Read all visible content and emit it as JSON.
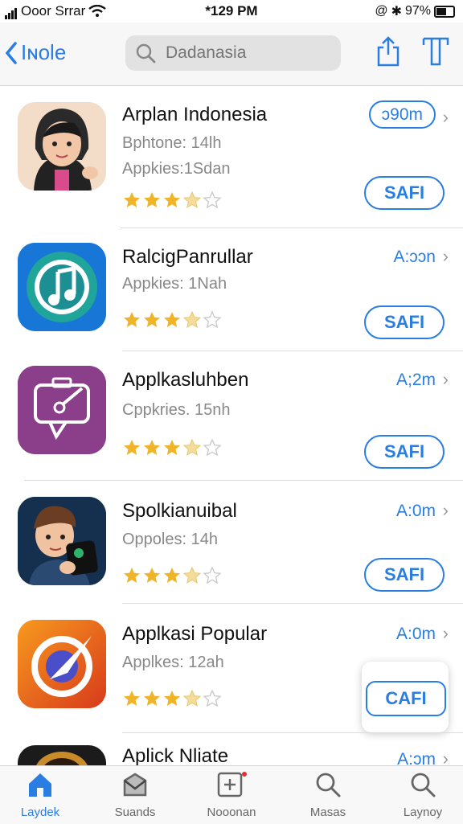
{
  "status": {
    "carrier": "Ooor Srrar",
    "time": "*129 PM",
    "battery": "97%"
  },
  "nav": {
    "back_label": "Iɴole",
    "search_placeholder": "Dadanasia"
  },
  "apps": [
    {
      "title": "Arplan Indonesia",
      "line1": "Bphtone: 14lh",
      "line2": "Appkies:1Sdan",
      "size": "ɔ90m",
      "button": "SAFI",
      "rating": 3.5
    },
    {
      "title": "RalcigPanrullar",
      "line1": "Appkies: 1Nah",
      "size": "A:ɔɔn",
      "button": "SAFI",
      "rating": 3.5
    },
    {
      "title": "Applkasluhben",
      "line1": "Cppkries. 15nh",
      "size": "A;2m",
      "button": "SAFI",
      "rating": 3.5
    },
    {
      "title": "Spolkianuibal",
      "line1": "Oppoles: 14h",
      "size": "A:0m",
      "button": "SAFI",
      "rating": 3.5
    },
    {
      "title": "Applkasi Popular",
      "line1": "Applkes: 12ah",
      "size": "A:0m",
      "button": "CAFI",
      "rating": 3.5
    },
    {
      "title": "Aplick Nliate",
      "size": "A:ɔm"
    }
  ],
  "tabs": [
    {
      "label": "Laydek",
      "icon": "home-icon",
      "active": true
    },
    {
      "label": "Suands",
      "icon": "inbox-icon"
    },
    {
      "label": "Nooonan",
      "icon": "add-icon"
    },
    {
      "label": "Masas",
      "icon": "search-icon"
    },
    {
      "label": "Laynoy",
      "icon": "search-icon"
    }
  ],
  "colors": {
    "accent": "#2a7de1",
    "star": "#f0b429"
  }
}
